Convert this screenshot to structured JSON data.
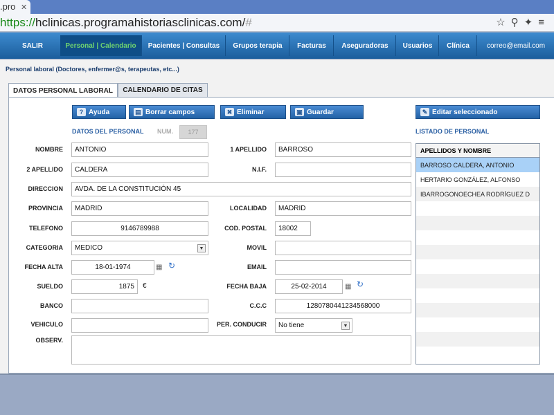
{
  "browser": {
    "tab_title": ".pro",
    "url_scheme": "https://",
    "url_host": "hclinicas.programahistoriasclinicas.com/",
    "url_hash": "#"
  },
  "nav": {
    "items": [
      {
        "label": "SALIR"
      },
      {
        "label": "Personal | Calendario"
      },
      {
        "label": "Pacientes | Consultas"
      },
      {
        "label": "Grupos terapia"
      },
      {
        "label": "Facturas"
      },
      {
        "label": "Aseguradoras"
      },
      {
        "label": "Usuarios"
      },
      {
        "label": "Clínica"
      }
    ],
    "email": "correo@email.com",
    "active_color": "#6fd36f"
  },
  "panel": {
    "title": "Personal laboral (Doctores, enfermer@s, terapeutas, etc...)",
    "tabs": [
      {
        "label": "DATOS PERSONAL LABORAL"
      },
      {
        "label": "CALENDARIO DE CITAS"
      }
    ]
  },
  "toolbar": {
    "ayuda": "Ayuda",
    "borrar": "Borrar campos",
    "eliminar": "Eliminar",
    "guardar": "Guardar",
    "editar": "Editar seleccionado"
  },
  "form": {
    "section_title": "DATOS DEL PERSONAL",
    "num_label": "NUM.",
    "num_value": "177",
    "nombre_label": "NOMBRE",
    "nombre": "ANTONIO",
    "apellido1_label": "1 APELLIDO",
    "apellido1": "BARROSO",
    "apellido2_label": "2 APELLIDO",
    "apellido2": "CALDERA",
    "nif_label": "N.I.F.",
    "nif": "",
    "direccion_label": "DIRECCION",
    "direccion": "AVDA. DE LA CONSTITUCIÓN 45",
    "provincia_label": "PROVINCIA",
    "provincia": "MADRID",
    "localidad_label": "LOCALIDAD",
    "localidad": "MADRID",
    "telefono_label": "TELEFONO",
    "telefono": "9146789988",
    "cp_label": "COD. POSTAL",
    "cp": "18002",
    "categoria_label": "CATEGORIA",
    "categoria": "MEDICO",
    "movil_label": "MOVIL",
    "movil": "",
    "fecha_alta_label": "FECHA ALTA",
    "fecha_alta": "18-01-1974",
    "email_label": "EMAIL",
    "email": "",
    "sueldo_label": "SUELDO",
    "sueldo": "1875",
    "currency": "€",
    "fecha_baja_label": "FECHA BAJA",
    "fecha_baja": "25-02-2014",
    "banco_label": "BANCO",
    "banco": "",
    "ccc_label": "C.C.C",
    "ccc": "1280780441234568000",
    "vehiculo_label": "VEHICULO",
    "vehiculo": "",
    "per_conducir_label": "PER. CONDUCIR",
    "per_conducir": "No tiene",
    "observ_label": "OBSERV.",
    "observ": ""
  },
  "listado": {
    "title": "LISTADO DE PERSONAL",
    "header": "APELLIDOS Y NOMBRE",
    "rows": [
      "BARROSO CALDERA, ANTONIO",
      "HERTARIO GONZÁLEZ, ALFONSO",
      "IBARROGONOECHEA RODRÍGUEZ D"
    ],
    "selected_color": "#a9d1f7"
  }
}
